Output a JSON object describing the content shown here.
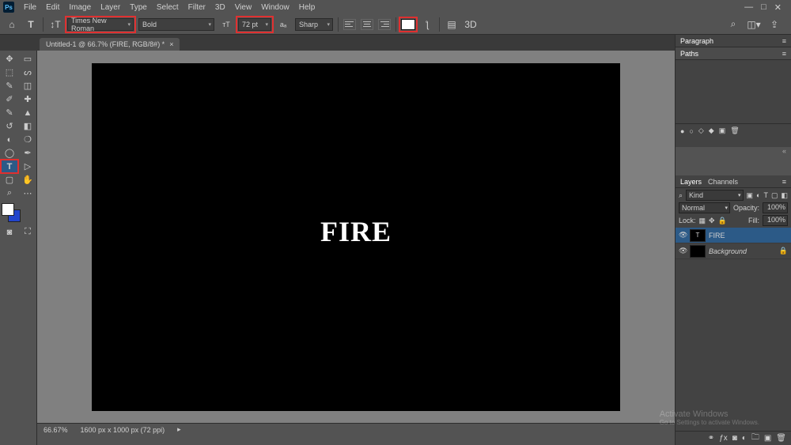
{
  "app": {
    "logo": "Ps"
  },
  "menu": [
    "File",
    "Edit",
    "Image",
    "Layer",
    "Type",
    "Select",
    "Filter",
    "3D",
    "View",
    "Window",
    "Help"
  ],
  "win_ctrl": {
    "min": "—",
    "max": "□",
    "close": "✕"
  },
  "options": {
    "font_family": "Times New Roman",
    "font_style": "Bold",
    "font_size": "72 pt",
    "aa": "Sharp",
    "color_swatch": "#ffffff",
    "threeD": "3D"
  },
  "doc_tab": {
    "title": "Untitled-1 @ 66.7% (FIRE, RGB/8#) *"
  },
  "canvas": {
    "text": "FIRE"
  },
  "status": {
    "zoom": "66.67%",
    "dims": "1600 px x 1000 px (72 ppi)"
  },
  "panels": {
    "paragraph_tab": "Paragraph",
    "paths_tab": "Paths",
    "layers_tab": "Layers",
    "channels_tab": "Channels",
    "kind_label": "Kind",
    "blend_mode": "Normal",
    "opacity_label": "Opacity:",
    "opacity_value": "100%",
    "lock_label": "Lock:",
    "fill_label": "Fill:",
    "fill_value": "100%"
  },
  "layers": [
    {
      "name": "FIRE",
      "selected": true,
      "thumb": "T",
      "locked": false,
      "italic": false
    },
    {
      "name": "Background",
      "selected": false,
      "thumb": "",
      "locked": true,
      "italic": true
    }
  ],
  "watermark": {
    "line1": "Activate Windows",
    "line2": "Go to Settings to activate Windows."
  }
}
